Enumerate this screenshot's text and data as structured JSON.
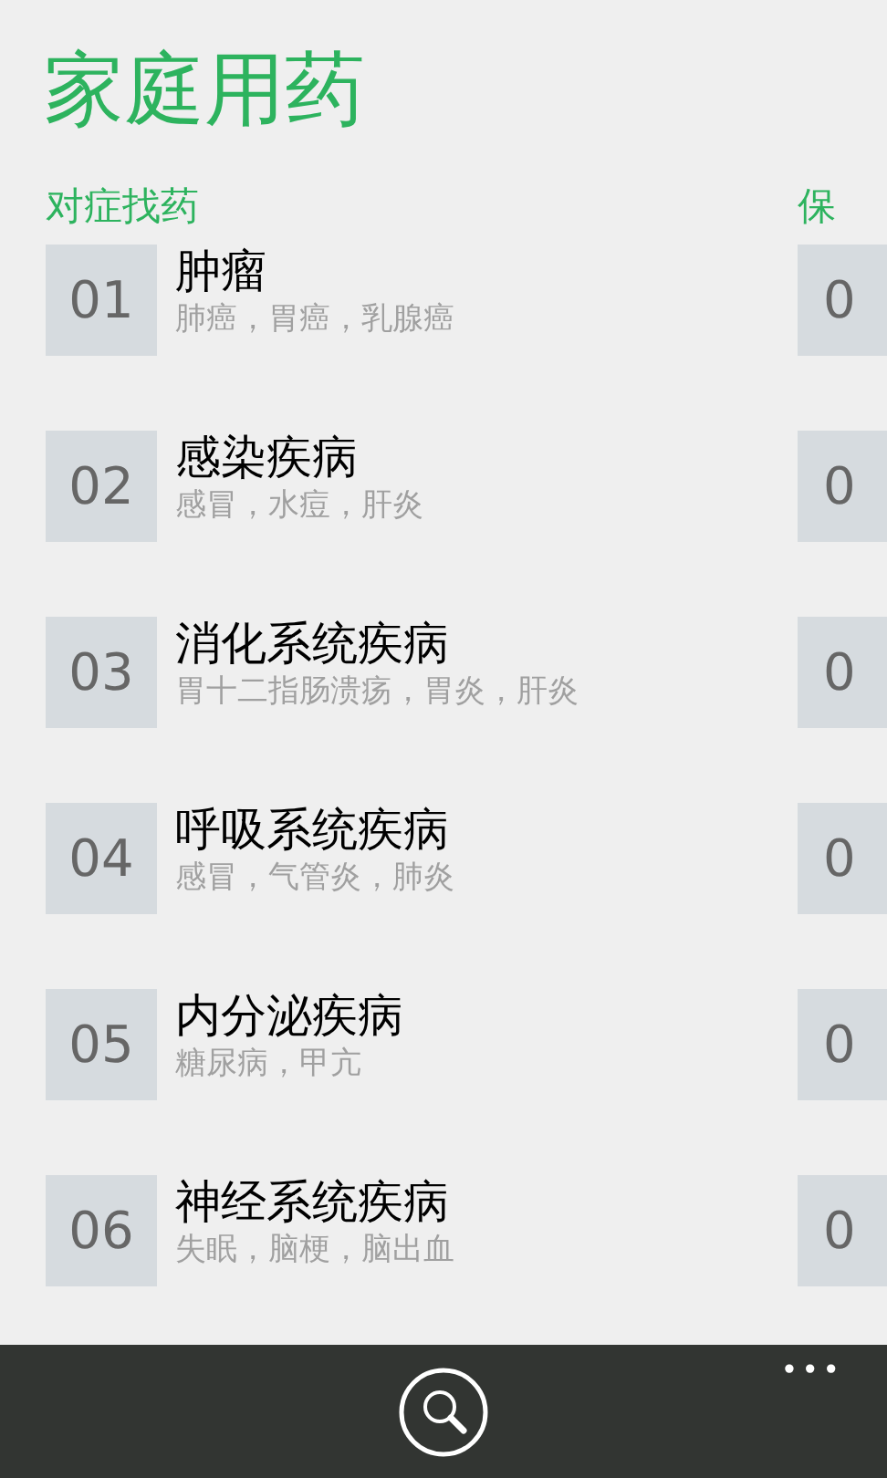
{
  "app_title": "家庭用药",
  "sections": [
    {
      "title": "对症找药",
      "items": [
        {
          "number": "01",
          "name": "肿瘤",
          "examples": "肺癌，胃癌，乳腺癌"
        },
        {
          "number": "02",
          "name": "感染疾病",
          "examples": "感冒，水痘，肝炎"
        },
        {
          "number": "03",
          "name": "消化系统疾病",
          "examples": "胃十二指肠溃疡，胃炎，肝炎"
        },
        {
          "number": "04",
          "name": "呼吸系统疾病",
          "examples": "感冒，气管炎，肺炎"
        },
        {
          "number": "05",
          "name": "内分泌疾病",
          "examples": "糖尿病，甲亢"
        },
        {
          "number": "06",
          "name": "神经系统疾病",
          "examples": "失眠，脑梗，脑出血"
        }
      ]
    },
    {
      "title": "保",
      "items": [
        {
          "number": "0"
        },
        {
          "number": "0"
        },
        {
          "number": "0"
        },
        {
          "number": "0"
        },
        {
          "number": "0"
        },
        {
          "number": "0"
        }
      ]
    }
  ],
  "app_bar": {
    "buttons": [
      {
        "kind": "search"
      }
    ],
    "more": "•••"
  }
}
